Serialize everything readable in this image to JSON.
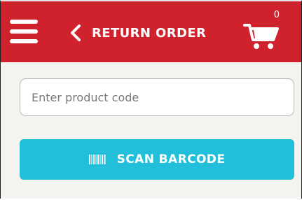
{
  "header": {
    "title": "RETURN ORDER",
    "menu_icon": "hamburger-menu-icon",
    "back_icon": "chevron-left-icon",
    "cart_icon": "shopping-cart-icon",
    "cart_count": "0",
    "background_color": "#d0222d"
  },
  "main": {
    "product_code_input": {
      "value": "",
      "placeholder": "Enter product code"
    },
    "scan_button": {
      "label": "SCAN BARCODE",
      "icon": "barcode-icon",
      "color": "#21bfd9"
    }
  }
}
